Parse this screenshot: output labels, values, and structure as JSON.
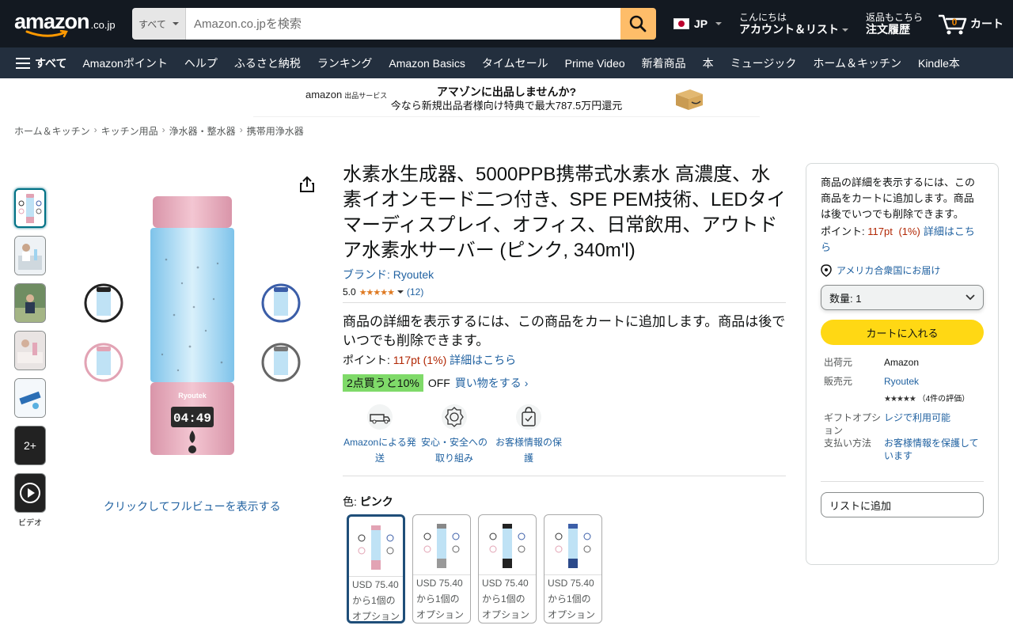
{
  "header": {
    "logo_word": "amazon",
    "logo_tld": ".co.jp",
    "search_category": "すべて",
    "search_placeholder": "Amazon.co.jpを検索",
    "lang": "JP",
    "account_l1": "こんにちは",
    "account_l2": "アカウント＆リスト",
    "orders_l1": "返品もこちら",
    "orders_l2": "注文履歴",
    "cart_label": "カート",
    "cart_count": "0"
  },
  "nav": {
    "all": "すべて",
    "items": [
      "Amazonポイント",
      "ヘルプ",
      "ふるさと納税",
      "ランキング",
      "Amazon Basics",
      "タイムセール",
      "Prime Video",
      "新着商品",
      "本",
      "ミュージック",
      "ホーム＆キッチン",
      "Kindle本"
    ]
  },
  "banner": {
    "brand": "amazon",
    "brand_sub": "出品サービス",
    "line1": "アマゾンに出品しませんか?",
    "line2": "今なら新規出品者様向け特典で最大787.5万円還元"
  },
  "breadcrumb": [
    "ホーム＆キッチン",
    "キッチン用品",
    "浄水器・整水器",
    "携帯用浄水器"
  ],
  "gallery": {
    "more_count": "2+",
    "video_label": "ビデオ",
    "fullview": "クリックしてフルビューを表示する",
    "device_display": "04:49",
    "device_brand": "Ryoutek"
  },
  "product": {
    "title": "水素水生成器、5000PPB携帯式水素水 高濃度、水素イオンモード二つ付き、SPE PEM技術、LEDタイマーディスプレイ、オフィス、日常飲用、アウトドア水素水サーバー (ピンク, 340m'l)",
    "brand": "ブランド: Ryoutek",
    "rating": "5.0",
    "stars": "★★★★★",
    "review_count": "(12)",
    "notice": "商品の詳細を表示するには、この商品をカートに追加します。商品は後でいつでも削除できます。",
    "points_label": "ポイント: ",
    "points_value": "117pt",
    "points_pct": "(1%)",
    "points_link": "詳細はこちら",
    "promo_badge": "2点買うと10%",
    "promo_off": "OFF",
    "promo_link": "買い物をする ›",
    "features": [
      {
        "label": "Amazonによる発送",
        "icon": "truck-icon"
      },
      {
        "label": "安心・安全への取り組み",
        "icon": "badge-icon"
      },
      {
        "label": "お客様情報の保護",
        "icon": "secure-bag-icon"
      }
    ],
    "color_label": "色: ",
    "color_value": "ピンク",
    "swatches": [
      {
        "price": "USD 75.40",
        "line2": "から1個の",
        "line3": "オプション",
        "color": "#e8b7c4"
      },
      {
        "price": "USD 75.40",
        "line2": "から1個の",
        "line3": "オプション",
        "color": "#9a9a9a"
      },
      {
        "price": "USD 75.40",
        "line2": "から1個の",
        "line3": "オプション",
        "color": "#333333"
      },
      {
        "price": "USD 75.40",
        "line2": "から1個の",
        "line3": "オプション",
        "color": "#3b5ea8"
      }
    ]
  },
  "buybox": {
    "notice": "商品の詳細を表示するには、この商品をカートに追加します。商品は後でいつでも削除できます。",
    "points_label": "ポイント: ",
    "points_value": "117pt",
    "points_pct": "(1%)",
    "points_link": "詳細はこちら",
    "location": "アメリカ合衆国にお届け",
    "qty_label": "数量: ",
    "qty_value": "1",
    "add_to_cart": "カートに入れる",
    "ships_from_k": "出荷元",
    "ships_from_v": "Amazon",
    "sold_by_k": "販売元",
    "sold_by_v": "Ryoutek",
    "seller_stars": "★★★★★",
    "seller_reviews": "（4件の評価）",
    "gift_k": "ギフトオプション",
    "gift_v": "レジで利用可能",
    "payment_k": "支払い方法",
    "payment_v": "お客様情報を保護しています",
    "add_to_list": "リストに追加"
  },
  "colors": {
    "nav_dark": "#131921",
    "nav_sub": "#232f3e",
    "search_btn": "#febd69",
    "cart_btn": "#ffd814",
    "link": "#2162a1",
    "price_red": "#b12704",
    "promo_green": "#7fda69"
  }
}
